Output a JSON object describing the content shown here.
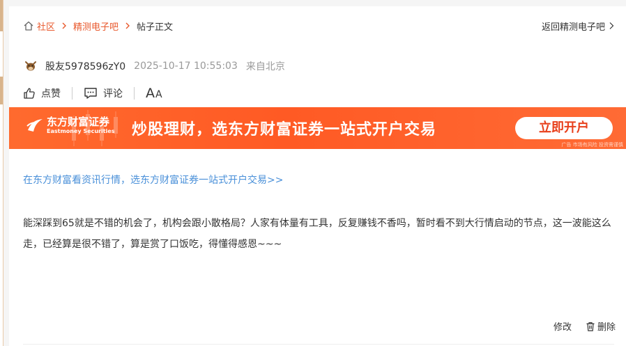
{
  "breadcrumb": {
    "items": [
      {
        "label": "社区",
        "icon": "home-icon"
      },
      {
        "label": "精测电子吧"
      }
    ],
    "current": "帖子正文"
  },
  "back_link": "返回精测电子吧",
  "author": {
    "name": "股友5978596zY0",
    "time": "2025-10-17 10:55:03",
    "location": "来自北京"
  },
  "actions": {
    "like": "点赞",
    "comment": "评论",
    "font_big": "A",
    "font_small": "A"
  },
  "banner": {
    "brand_cn": "东方财富证券",
    "brand_en": "Eastmoney Securities",
    "slogan": "炒股理财，选东方财富证券一站式开户交易",
    "button": "立即开户",
    "note": "广告 市场有风险 投资需谨慎"
  },
  "promo_link": "在东方财富看资讯行情，选东方财富证券一站式开户交易>>",
  "post": {
    "body": "能深踩到65就是不错的机会了，机构会跟小散格局？人家有体量有工具，反复赚钱不香吗，暂时看不到大行情启动的节点，这一波能这么走，已经算是很不错了，算是赏了口饭吃，得懂得感恩~~~"
  },
  "footer": {
    "edit": "修改",
    "delete": "删除"
  },
  "colors": {
    "accent": "#e8582c",
    "banner": "#ff5a24",
    "link": "#4a90d9"
  }
}
